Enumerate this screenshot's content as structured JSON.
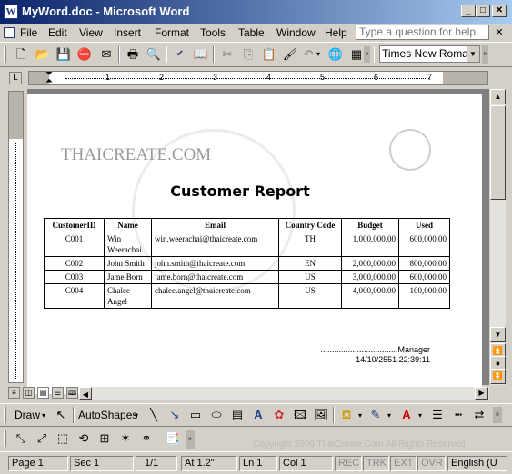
{
  "window": {
    "app_icon_letter": "W",
    "title": "MyWord.doc - Microsoft Word",
    "minimize": "_",
    "maximize": "□",
    "close": "✕"
  },
  "menu": {
    "items": [
      "File",
      "Edit",
      "View",
      "Insert",
      "Format",
      "Tools",
      "Table",
      "Window",
      "Help"
    ],
    "help_placeholder": "Type a question for help",
    "close_doc": "✕"
  },
  "toolbar": {
    "font_name": "Times New Roman"
  },
  "ruler": {
    "marks": [
      "1",
      "2",
      "3",
      "4",
      "5",
      "6",
      "7"
    ]
  },
  "document": {
    "site_name": "THAICREATE.COM",
    "report_title": "Customer Report",
    "table": {
      "headers": [
        "CustomerID",
        "Name",
        "Email",
        "Country Code",
        "Budget",
        "Used"
      ],
      "rows": [
        [
          "C001",
          "Win Weerachai",
          "win.weerachai@thaicreate.com",
          "TH",
          "1,000,000.00",
          "600,000.00"
        ],
        [
          "C002",
          "John Smith",
          "john.smith@thaicreate.com",
          "EN",
          "2,000,000.00",
          "800,000.00"
        ],
        [
          "C003",
          "Jame Born",
          "jame.born@thaicreate.com",
          "US",
          "3,000,000.00",
          "600,000.00"
        ],
        [
          "C004",
          "Chalee Angel",
          "chalee.angel@thaicreate.com",
          "US",
          "4,000,000.00",
          "100,000.00"
        ]
      ]
    },
    "signature_line": "..................................Manager",
    "signature_date": "14/10/2551 22:39:11"
  },
  "drawing_toolbar": {
    "draw_label": "Draw",
    "autoshapes_label": "AutoShapes"
  },
  "watermark_text": "Copyright 2009 ThaiCreate.Com All Rights Reserved",
  "status": {
    "page": "Page 1",
    "sec": "Sec 1",
    "page_of": "1/1",
    "at": "At 1.2\"",
    "ln": "Ln 1",
    "col": "Col 1",
    "rec": "REC",
    "trk": "TRK",
    "ext": "EXT",
    "ovr": "OVR",
    "language": "English (U"
  }
}
